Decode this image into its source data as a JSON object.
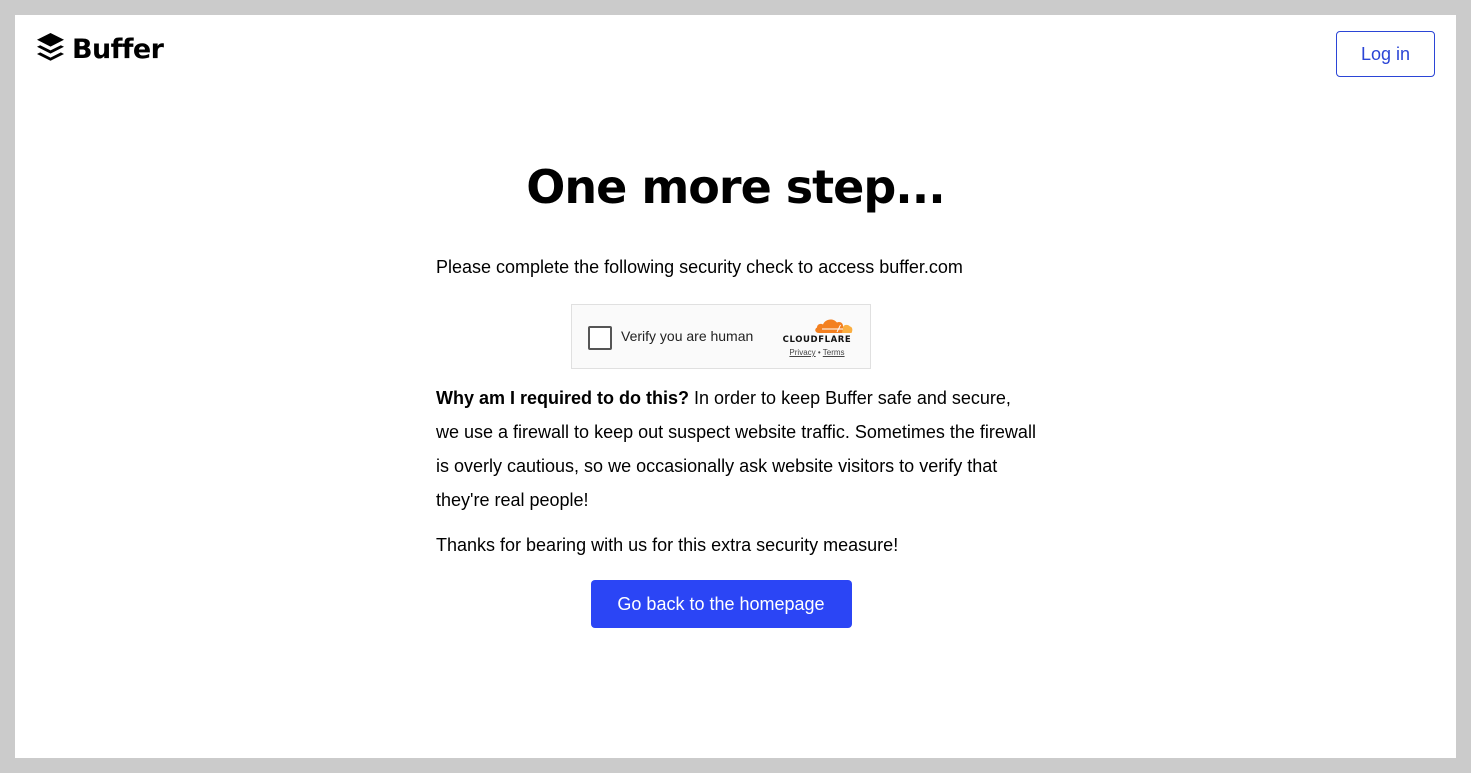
{
  "header": {
    "logo_text": "Buffer",
    "logo_icon": "buffer-stack-icon",
    "login_label": "Log in"
  },
  "main": {
    "title": "One more step...",
    "intro": "Please complete the following security check to access buffer.com",
    "why_heading": "Why am I required to do this?",
    "why_body": " In order to keep Buffer safe and secure, we use a firewall to keep out suspect website traffic. Sometimes the firewall is overly cautious, so we occasionally ask website visitors to verify that they're real people!",
    "thanks": "Thanks for bearing with us for this extra security measure!",
    "home_button_label": "Go back to the homepage"
  },
  "turnstile": {
    "checkbox_label": "Verify you are human",
    "brand": "CLOUDFLARE",
    "privacy_label": "Privacy",
    "separator": "•",
    "terms_label": "Terms",
    "checked": false
  },
  "colors": {
    "accent": "#2b45f5",
    "login_border": "#2b45d6",
    "cloudflare_orange": "#f38020",
    "cloudflare_light": "#faae40",
    "frame_background": "#cbcbcb"
  }
}
